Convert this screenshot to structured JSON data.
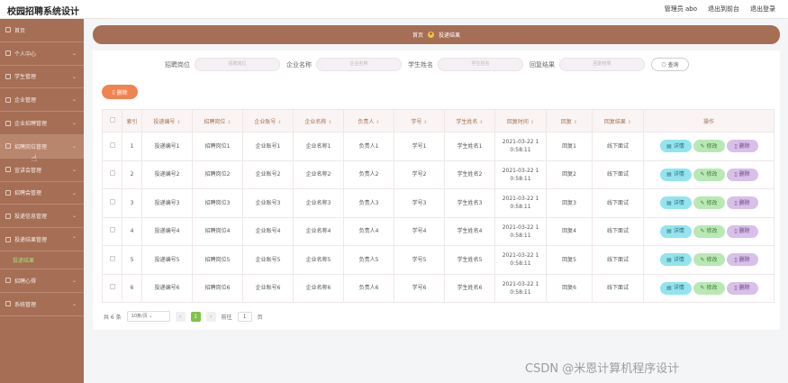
{
  "header": {
    "app_title": "校园招聘系统设计",
    "links": [
      "管理员 abo",
      "退出到前台",
      "退出登录"
    ]
  },
  "sidebar": {
    "items": [
      {
        "label": "首页",
        "icon": "home-icon"
      },
      {
        "label": "个人中心",
        "icon": "user-icon"
      },
      {
        "label": "学生管理",
        "icon": "folder-icon"
      },
      {
        "label": "企业管理",
        "icon": "folder-icon"
      },
      {
        "label": "企业招聘管理",
        "icon": "folder-icon"
      },
      {
        "label": "招聘岗位管理",
        "icon": "folder-icon"
      },
      {
        "label": "宣讲会管理",
        "icon": "folder-icon"
      },
      {
        "label": "招聘会管理",
        "icon": "folder-icon"
      },
      {
        "label": "投递信息管理",
        "icon": "folder-icon"
      },
      {
        "label": "投递结果管理",
        "icon": "folder-icon"
      },
      {
        "label": "招聘心得",
        "icon": "folder-icon"
      },
      {
        "label": "系统管理",
        "icon": "folder-icon"
      }
    ],
    "sub_item": "投递结果",
    "active_index": 5
  },
  "breadcrumb": {
    "home": "首页",
    "current": "投递结果"
  },
  "search": {
    "fields": [
      {
        "label": "招聘岗位",
        "placeholder": "招聘岗位"
      },
      {
        "label": "企业名称",
        "placeholder": "企业名称"
      },
      {
        "label": "学生姓名",
        "placeholder": "学生姓名"
      },
      {
        "label": "回复结果",
        "placeholder": "回复结果"
      }
    ],
    "button": "查询"
  },
  "bulk_delete": "删除",
  "table": {
    "headers": [
      "索引",
      "投递编号",
      "招聘岗位",
      "企业账号",
      "企业名称",
      "负责人",
      "学号",
      "学生姓名",
      "回复时间",
      "回复",
      "回复结果",
      "操作"
    ],
    "rows": [
      [
        "1",
        "投递编号1",
        "招聘岗位1",
        "企业账号1",
        "企业名称1",
        "负责人1",
        "学号1",
        "学生姓名1",
        "2021-03-22 1\n0:58:11",
        "回复1",
        "线下面试"
      ],
      [
        "2",
        "投递编号2",
        "招聘岗位2",
        "企业账号2",
        "企业名称2",
        "负责人2",
        "学号2",
        "学生姓名2",
        "2021-03-22 1\n0:58:11",
        "回复2",
        "线下面试"
      ],
      [
        "3",
        "投递编号3",
        "招聘岗位3",
        "企业账号3",
        "企业名称3",
        "负责人3",
        "学号3",
        "学生姓名3",
        "2021-03-22 1\n0:58:11",
        "回复3",
        "线下面试"
      ],
      [
        "4",
        "投递编号4",
        "招聘岗位4",
        "企业账号4",
        "企业名称4",
        "负责人4",
        "学号4",
        "学生姓名4",
        "2021-03-22 1\n0:58:11",
        "回复4",
        "线下面试"
      ],
      [
        "5",
        "投递编号5",
        "招聘岗位5",
        "企业账号5",
        "企业名称5",
        "负责人5",
        "学号5",
        "学生姓名5",
        "2021-03-22 1\n0:58:11",
        "回复5",
        "线下面试"
      ],
      [
        "6",
        "投递编号6",
        "招聘岗位6",
        "企业账号6",
        "企业名称6",
        "负责人6",
        "学号6",
        "学生姓名6",
        "2021-03-22 1\n0:58:11",
        "回复6",
        "线下面试"
      ]
    ],
    "actions": {
      "detail": "详情",
      "edit": "修改",
      "delete": "删除"
    }
  },
  "pager": {
    "total": "共 6 条",
    "page_size": "10条/页",
    "current": "1",
    "goto_label": "前往",
    "goto_value": "1",
    "page_suffix": "页"
  },
  "watermark": "CSDN @米恩计算机程序设计"
}
